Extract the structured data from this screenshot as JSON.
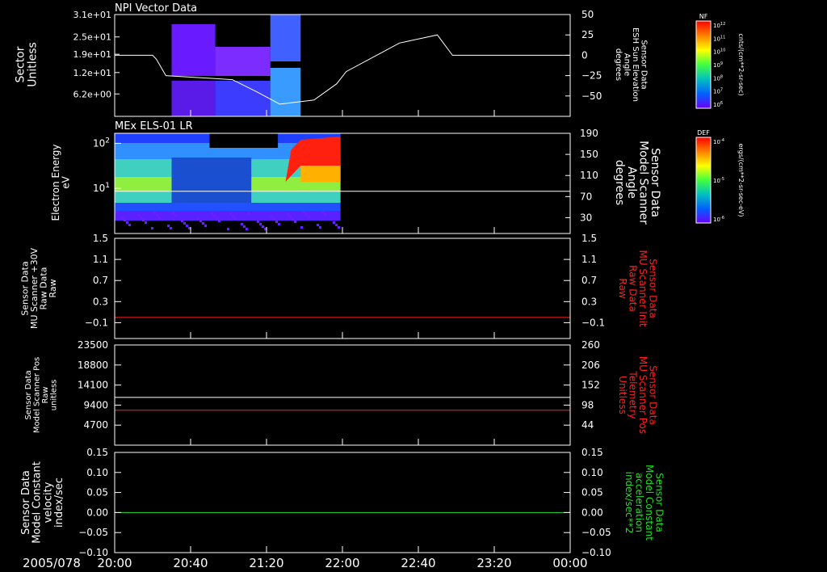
{
  "footer": {
    "date": "2005/078",
    "x_ticks": [
      "20:00",
      "20:40",
      "21:20",
      "22:00",
      "22:40",
      "23:20",
      "00:00"
    ]
  },
  "colors": {
    "white": "#ffffff",
    "red": "#ff2020",
    "green": "#20e020",
    "purple_block": "#6a00ff"
  },
  "chart_data": [
    {
      "type": "heatmap",
      "title": "NPI Vector Data",
      "ylabel": "Sector\nUnitless",
      "yticks": [
        "3.1e+01",
        "2.5e+01",
        "1.9e+01",
        "1.2e+01",
        "6.2e+00"
      ],
      "overlay": {
        "type": "line",
        "label": "Sensor Data\nESH Sun Elevation\nAngle\ndegrees",
        "yticks": [
          "50",
          "25",
          "0",
          "-25",
          "-50"
        ],
        "ylim": [
          -75,
          50
        ],
        "x": [
          0,
          20,
          22,
          27,
          62,
          75,
          87,
          105,
          117,
          122,
          142,
          150,
          170,
          178,
          240
        ],
        "y": [
          0,
          0,
          -5,
          -25,
          -30,
          -45,
          -60,
          -55,
          -35,
          -20,
          5,
          15,
          25,
          0,
          0
        ]
      },
      "colorbar": {
        "label": "NF",
        "unit": "cnts/(cm**2-sr-sec)",
        "ticks": [
          "10^12",
          "10^11",
          "10^10",
          "10^9",
          "10^8",
          "10^7",
          "10^6"
        ]
      }
    },
    {
      "type": "heatmap",
      "title": "MEx ELS-01 LR",
      "ylabel": "Electron Energy\neV",
      "yticks": [
        "10^2",
        "10^1"
      ],
      "overlay": {
        "type": "line",
        "label": "Sensor Data\nModel Scanner\nAngle\ndegrees",
        "yticks": [
          "190",
          "150",
          "110",
          "70",
          "30"
        ],
        "ylim": [
          0,
          190
        ],
        "value": 80
      },
      "colorbar": {
        "label": "DEF",
        "unit": "ergs/(cm**2-sr-sec-eV)",
        "ticks": [
          "10^-4",
          "10^-5",
          "10^-6"
        ]
      }
    },
    {
      "type": "line",
      "ylabel": "Sensor Data\nMU Scanner +30V\nRaw Data\nRaw",
      "rlabel": "Sensor Data\nMU Scanner Init\nRaw Data\nRaw",
      "yticks": [
        "1.5",
        "1.1",
        "0.7",
        "0.3",
        "-0.1"
      ],
      "ylim": [
        -0.4,
        1.5
      ],
      "series": [
        {
          "color": "red",
          "value": 0.0
        }
      ]
    },
    {
      "type": "line",
      "ylabel": "Sensor Data\nModel Scanner Pos\nRaw\nunitless",
      "rlabel": "Sensor Data\nMU Scanner Pos\nTelemetry\nUnitless",
      "yticks": [
        "23500",
        "18800",
        "14100",
        "9400",
        "4700"
      ],
      "rticks": [
        "260",
        "206",
        "152",
        "98",
        "44"
      ],
      "ylim": [
        0,
        23500
      ],
      "series": [
        {
          "color": "white",
          "value": 11200
        },
        {
          "color": "red",
          "value": 8200
        }
      ]
    },
    {
      "type": "line",
      "ylabel": "Sensor Data\nModel Constant\nvelocity\nindex/sec",
      "rlabel": "Sensor Data\nModel Constant\nacceleration\nindex/sec**2",
      "yticks": [
        "0.15",
        "0.10",
        "0.05",
        "0.00",
        "-0.05",
        "-0.10"
      ],
      "ylim": [
        -0.1,
        0.15
      ],
      "series": [
        {
          "color": "green",
          "value": 0.0
        }
      ]
    }
  ]
}
